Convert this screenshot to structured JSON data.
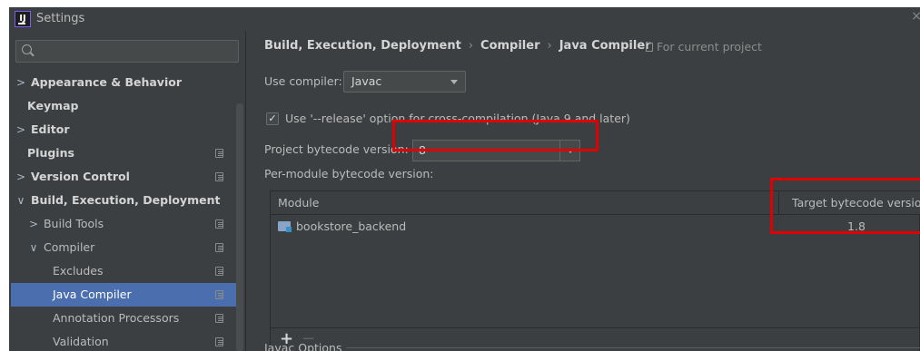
{
  "window": {
    "title": "Settings",
    "app_icon_text": "IJ",
    "close_symbol": "×"
  },
  "search": {
    "placeholder": "",
    "value": ""
  },
  "sidebar": {
    "items": [
      {
        "label": "Appearance & Behavior",
        "arrow": ">",
        "bold": true,
        "project": false
      },
      {
        "label": "Keymap",
        "arrow": "",
        "bold": true,
        "project": false
      },
      {
        "label": "Editor",
        "arrow": ">",
        "bold": true,
        "project": false
      },
      {
        "label": "Plugins",
        "arrow": "",
        "bold": true,
        "project": true
      },
      {
        "label": "Version Control",
        "arrow": ">",
        "bold": true,
        "project": true
      },
      {
        "label": "Build, Execution, Deployment",
        "arrow": "∨",
        "bold": true,
        "project": false
      },
      {
        "label": "Build Tools",
        "arrow": ">",
        "bold": false,
        "project": true
      },
      {
        "label": "Compiler",
        "arrow": "∨",
        "bold": false,
        "project": true
      },
      {
        "label": "Excludes",
        "arrow": "",
        "bold": false,
        "project": true
      },
      {
        "label": "Java Compiler",
        "arrow": "",
        "bold": false,
        "project": true,
        "selected": true
      },
      {
        "label": "Annotation Processors",
        "arrow": "",
        "bold": false,
        "project": true
      },
      {
        "label": "Validation",
        "arrow": "",
        "bold": false,
        "project": true
      }
    ]
  },
  "breadcrumb": {
    "parts": [
      "Build, Execution, Deployment",
      "Compiler",
      "Java Compiler"
    ],
    "separator": "›",
    "scope": "For current project"
  },
  "compiler": {
    "use_compiler_label": "Use compiler:",
    "use_compiler_value": "Javac",
    "release_option_label": "Use '--release' option for cross-compilation (Java 9 and later)",
    "release_option_checked": true,
    "check_mark": "✓",
    "project_bytecode_label": "Project bytecode version:",
    "project_bytecode_value": "8",
    "per_module_label": "Per-module bytecode version:"
  },
  "module_table": {
    "columns": [
      "Module",
      "Target bytecode version"
    ],
    "rows": [
      {
        "module": "bookstore_backend",
        "target": "1.8"
      }
    ],
    "add_symbol": "+",
    "remove_symbol": "−"
  },
  "javac_options_label": "Javac Options",
  "colors": {
    "background": "#3c3f41",
    "selection": "#4b6eaf",
    "highlight_box": "#e00000",
    "text": "#bbbbbb"
  }
}
